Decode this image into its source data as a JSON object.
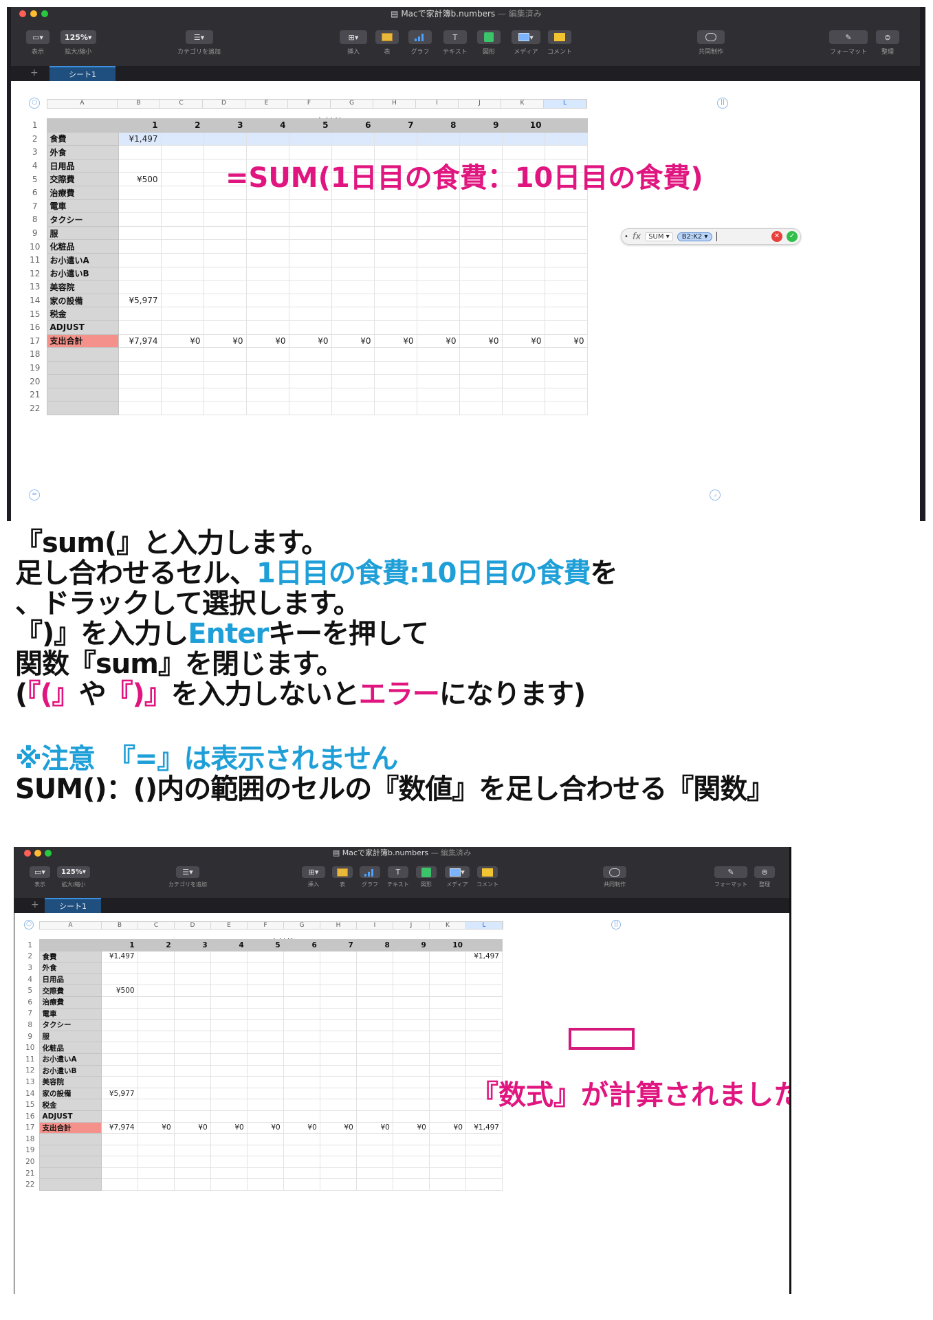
{
  "window": {
    "title": "Macで家計簿b.numbers",
    "title_suffix": "— 編集済み"
  },
  "toolbar": {
    "view_label": "表示",
    "zoom_value": "125%",
    "zoom_label": "拡大/縮小",
    "category_label": "カテゴリを追加",
    "insert_label": "挿入",
    "table_label": "表",
    "chart_label": "グラフ",
    "text_label": "テキスト",
    "shape_label": "図形",
    "media_label": "メディア",
    "comment_label": "コメント",
    "collab_label": "共同制作",
    "format_label": "フォーマット",
    "organize_label": "整理"
  },
  "sheet_tab": "シート1",
  "columns": [
    "A",
    "B",
    "C",
    "D",
    "E",
    "F",
    "G",
    "H",
    "I",
    "J",
    "K",
    "L"
  ],
  "sheet": {
    "title": "Macで家計簿",
    "header_days": [
      "1",
      "2",
      "3",
      "4",
      "5",
      "6",
      "7",
      "8",
      "9",
      "10",
      ""
    ],
    "row_numbers": [
      "1",
      "2",
      "3",
      "4",
      "5",
      "6",
      "7",
      "8",
      "9",
      "10",
      "11",
      "12",
      "13",
      "14",
      "15",
      "16",
      "17",
      "18",
      "19",
      "20",
      "21",
      "22"
    ],
    "categories": [
      "食費",
      "外食",
      "日用品",
      "交際費",
      "治療費",
      "電車",
      "タクシー",
      "服",
      "化粧品",
      "お小遣いA",
      "お小遣いB",
      "美容院",
      "家の設備",
      "税金",
      "ADJUST",
      "支出合計"
    ],
    "values": {
      "r2_b": "¥1,497",
      "r5_b": "¥500",
      "r14_b": "¥5,977",
      "r17": [
        "¥7,974",
        "¥0",
        "¥0",
        "¥0",
        "¥0",
        "¥0",
        "¥0",
        "¥0",
        "¥0",
        "¥0",
        "¥0"
      ],
      "r17_after": [
        "¥7,974",
        "¥0",
        "¥0",
        "¥0",
        "¥0",
        "¥0",
        "¥0",
        "¥0",
        "¥0",
        "¥0",
        "¥1,497"
      ],
      "l2_result": "¥1,497"
    }
  },
  "formula_bar": {
    "fx": "fx",
    "function": "SUM ▾",
    "range": "B2:K2 ▾"
  },
  "annotations": {
    "formula_caption": "=SUM(1日目の食費：10日目の食費)",
    "result_caption": "『数式』が計算されました"
  },
  "instructions": {
    "line1": "『sum(』と入力します。",
    "line2_a": "足し合わせるセル、",
    "line2_b": "1日目の食費:10日目の食費",
    "line2_c": "を",
    "line3": "、ドラックして選択します。",
    "line4_a": "『)』を入力し",
    "line4_b": "Enter",
    "line4_c": "キーを押して",
    "line5": "関数『sum』を閉じます。",
    "line6_a": "(",
    "line6_b": "『(』",
    "line6_c": "や",
    "line6_d": "『)』",
    "line6_e": "を入力しないと",
    "line6_f": "エラー",
    "line6_g": "になります)",
    "note": "※注意　『=』は表示されません",
    "definition": "SUM()：()内の範囲のセルの『数値』を足し合わせる『関数』"
  }
}
